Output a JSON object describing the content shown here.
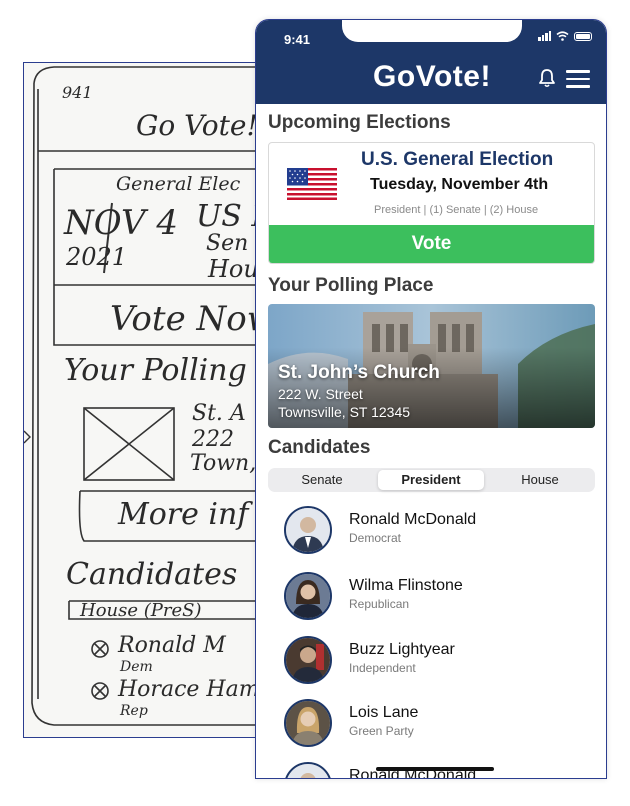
{
  "sketch": {
    "time": "941",
    "title": "Go Vote!",
    "election_label": "General Elec",
    "date_line1": "NOV 4",
    "date_line2": "2021",
    "races_line1": "US P",
    "races_line2": "Sen",
    "races_line3": "Hou",
    "vote_button": "Vote Now",
    "polling_title": "Your Polling Plac",
    "place_line1": "St. A",
    "place_line2": "222",
    "place_line3": "Town,",
    "more_button": "More inf",
    "candidates_title": "Candidates",
    "tabs": "House (PreS)",
    "cand1_name": "Ronald M",
    "cand1_party": "Dem",
    "cand2_name": "Horace Ham",
    "cand2_party": "Rep"
  },
  "status": {
    "time": "9:41"
  },
  "header": {
    "title": "GoVote!"
  },
  "upcoming": {
    "title": "Upcoming Elections",
    "election_name": "U.S. General Election",
    "date": "Tuesday, November 4th",
    "races": "President | (1) Senate | (2) House",
    "vote_label": "Vote"
  },
  "polling": {
    "title": "Your Polling Place",
    "name": "St. John’s Church",
    "street": "222 W. Street",
    "city": "Townsville, ST 12345"
  },
  "candidates": {
    "title": "Candidates",
    "tabs": [
      "Senate",
      "President",
      "House"
    ],
    "active_tab": "President",
    "list": [
      {
        "name": "Ronald McDonald",
        "party": "Democrat"
      },
      {
        "name": "Wilma Flinstone",
        "party": "Republican"
      },
      {
        "name": "Buzz Lightyear",
        "party": "Independent"
      },
      {
        "name": "Lois Lane",
        "party": "Green Party"
      },
      {
        "name": "Ronald McDonald",
        "party": ""
      }
    ]
  },
  "colors": {
    "navy": "#1d3768",
    "vote_green": "#3cbf5d",
    "sketch_border": "#2b3d8f"
  }
}
